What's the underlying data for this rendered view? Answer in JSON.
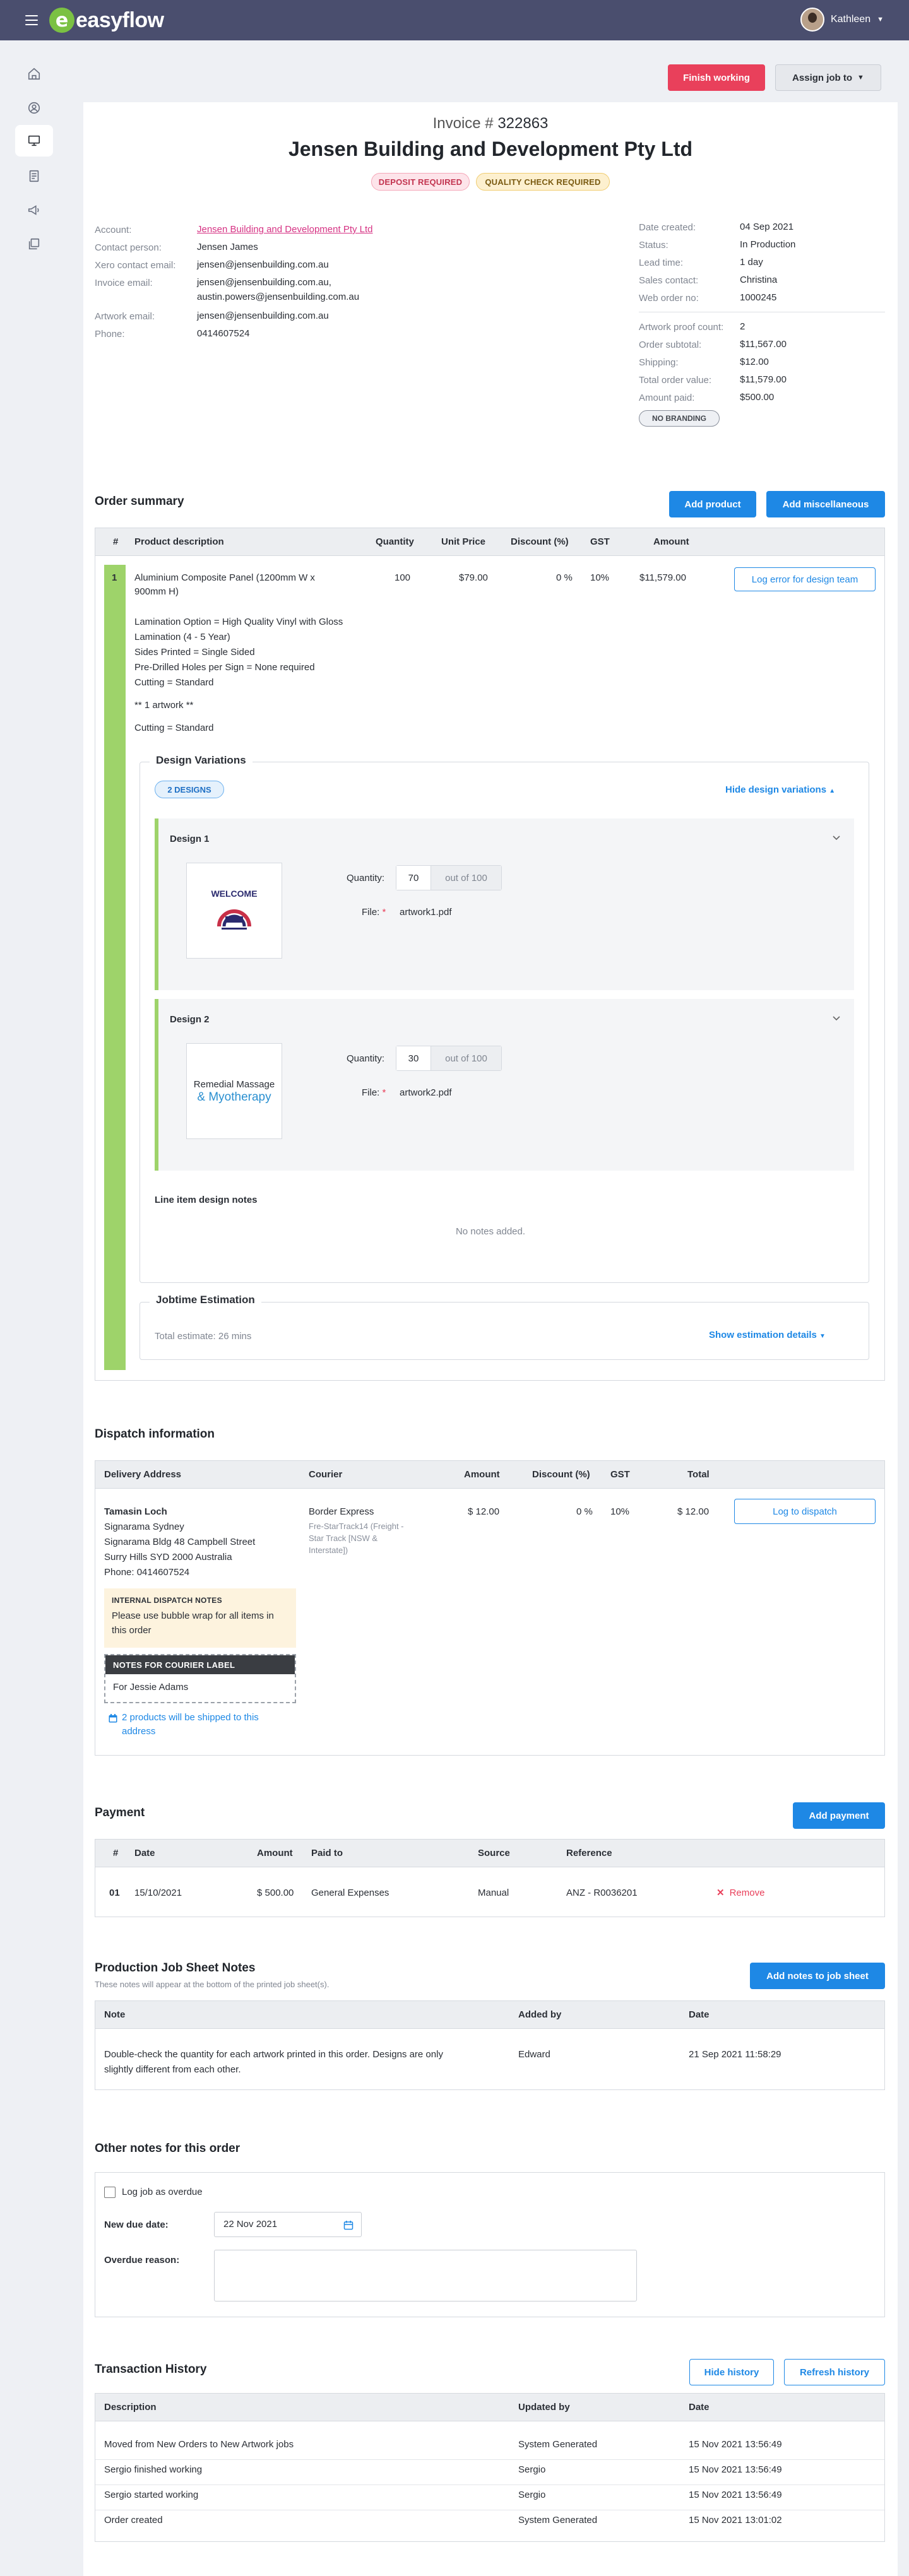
{
  "app": {
    "brand_letter": "e",
    "brand": "easyflow",
    "user": "Kathleen"
  },
  "sidebar": {
    "icons": [
      "home-icon",
      "user-icon",
      "monitor-icon",
      "document-icon",
      "megaphone-icon",
      "layers-icon"
    ]
  },
  "header": {
    "finish_label": "Finish working",
    "assign_label": "Assign job to"
  },
  "invoice": {
    "label": "Invoice #",
    "number": "322863",
    "company": "Jensen Building and Development Pty Ltd",
    "tags": [
      "DEPOSIT REQUIRED",
      "QUALITY CHECK REQUIRED"
    ]
  },
  "details_left": [
    {
      "label": "Account:",
      "value": "Jensen Building and Development Pty Ltd"
    },
    {
      "label": "Contact person:",
      "value": "Jensen James"
    },
    {
      "label": "Xero contact email:",
      "value": "jensen@jensenbuilding.com.au"
    },
    {
      "label": "Invoice email:",
      "value": "jensen@jensenbuilding.com.au,",
      "value2": "austin.powers@jensenbuilding.com.au"
    },
    {
      "label": "Artwork email:",
      "value": "jensen@jensenbuilding.com.au"
    },
    {
      "label": "Phone:",
      "value": "0414607524"
    }
  ],
  "details_right": [
    {
      "label": "Date created:",
      "value": "04 Sep 2021"
    },
    {
      "label": "Status:",
      "value": "In Production"
    },
    {
      "label": "Lead time:",
      "value": "1 day"
    },
    {
      "label": "Sales contact:",
      "value": "Christina"
    },
    {
      "label": "Web order no:",
      "value": "1000245"
    }
  ],
  "totals": [
    {
      "label": "Artwork proof count:",
      "value": "2"
    },
    {
      "label": "Order subtotal:",
      "value": "$11,567.00"
    },
    {
      "label": "Shipping:",
      "value": "$12.00"
    },
    {
      "label": "Total order value:",
      "value": "$11,579.00"
    },
    {
      "label": "Amount paid:",
      "value": "$500.00"
    }
  ],
  "branding_pill": "NO BRANDING",
  "order": {
    "title": "Order summary",
    "add_product": "Add product",
    "add_misc": "Add miscellaneous",
    "columns": [
      "#",
      "Product description",
      "Quantity",
      "Unit Price",
      "Discount (%)",
      "GST",
      "Amount"
    ],
    "row": {
      "num": "1",
      "desc1": "Aluminium Composite Panel (1200mm W x",
      "desc2": "900mm H)",
      "qty": "100",
      "unit": "$79.00",
      "disc": "0 %",
      "gst": "10%",
      "amount": "$11,579.00",
      "log_error": "Log error for design team"
    },
    "options": [
      "Lamination Option = High Quality Vinyl with Gloss",
      "Lamination (4 - 5 Year)",
      "Sides Printed = Single Sided",
      "Pre-Drilled Holes per Sign = None required",
      "Cutting = Standard"
    ],
    "artwork_note": "** 1 artwork **",
    "cutting": "Cutting = Standard",
    "design_variations": {
      "legend": "Design Variations",
      "count_pill": "2 DESIGNS",
      "hide": "Hide design variations",
      "designs": [
        {
          "title": "Design 1",
          "qty_label": "Quantity:",
          "qty": "70",
          "out_of": "out of 100",
          "file_label": "File:",
          "file": "artwork1.pdf",
          "thumb_text": "WELCOME"
        },
        {
          "title": "Design 2",
          "qty_label": "Quantity:",
          "qty": "30",
          "out_of": "out of 100",
          "file_label": "File:",
          "file": "artwork2.pdf",
          "thumb_text1": "Remedial Massage",
          "thumb_text2": "& Myotherapy"
        }
      ],
      "notes_title": "Line item design notes",
      "notes_empty": "No notes added."
    },
    "jobtime": {
      "legend": "Jobtime Estimation",
      "total": "Total estimate: 26 mins",
      "show": "Show estimation details"
    }
  },
  "dispatch": {
    "title": "Dispatch information",
    "columns": [
      "Delivery Address",
      "Courier",
      "Amount",
      "Discount (%)",
      "GST",
      "Total"
    ],
    "name": "Tamasin Loch",
    "addr1": "Signarama Sydney",
    "addr2": "Signarama Bldg 48 Campbell Street",
    "addr3": "Surry Hills SYD 2000 Australia",
    "phone": "Phone: 0414607524",
    "courier": "Border Express",
    "courier_sub": "Fre-StarTrack14 (Freight - Star Track [NSW & Interstate])",
    "amount": "$ 12.00",
    "disc": "0 %",
    "gst": "10%",
    "total": "$ 12.00",
    "log": "Log to dispatch",
    "internal_title": "INTERNAL DISPATCH NOTES",
    "internal_text": "Please use bubble wrap for all items in this order",
    "courier_title": "NOTES FOR COURIER LABEL",
    "courier_text": "For Jessie Adams",
    "ship_note": "2 products will be shipped to this address"
  },
  "payment": {
    "title": "Payment",
    "add": "Add payment",
    "columns": [
      "#",
      "Date",
      "Amount",
      "Paid to",
      "Source",
      "Reference"
    ],
    "row": {
      "num": "01",
      "date": "15/10/2021",
      "amount": "$ 500.00",
      "paid_to": "General Expenses",
      "source": "Manual",
      "ref": "ANZ - R0036201",
      "remove": "Remove"
    }
  },
  "production": {
    "title": "Production Job Sheet Notes",
    "subtitle": "These notes will appear at the bottom of the printed job sheet(s).",
    "add": "Add notes to job sheet",
    "columns": [
      "Note",
      "Added by",
      "Date"
    ],
    "row": {
      "note1": "Double-check the quantity for each artwork printed in this order. Designs are only",
      "note2": "slightly different from each other.",
      "by": "Edward",
      "date": "21 Sep 2021 11:58:29"
    }
  },
  "other": {
    "title": "Other notes for this order",
    "overdue": "Log job as overdue",
    "due_label": "New due date:",
    "due": "22 Nov 2021",
    "reason_label": "Overdue reason:"
  },
  "history": {
    "title": "Transaction History",
    "hide": "Hide history",
    "refresh": "Refresh history",
    "columns": [
      "Description",
      "Updated by",
      "Date"
    ],
    "rows": [
      {
        "desc": "Moved from New Orders to New Artwork jobs",
        "by": "System Generated",
        "date": "15 Nov 2021 13:56:49"
      },
      {
        "desc": "Sergio finished working",
        "by": "Sergio",
        "date": "15 Nov 2021 13:56:49"
      },
      {
        "desc": "Sergio started working",
        "by": "Sergio",
        "date": "15 Nov 2021 13:56:49"
      },
      {
        "desc": "Order created",
        "by": "System Generated",
        "date": "15 Nov 2021 13:01:02"
      }
    ]
  }
}
